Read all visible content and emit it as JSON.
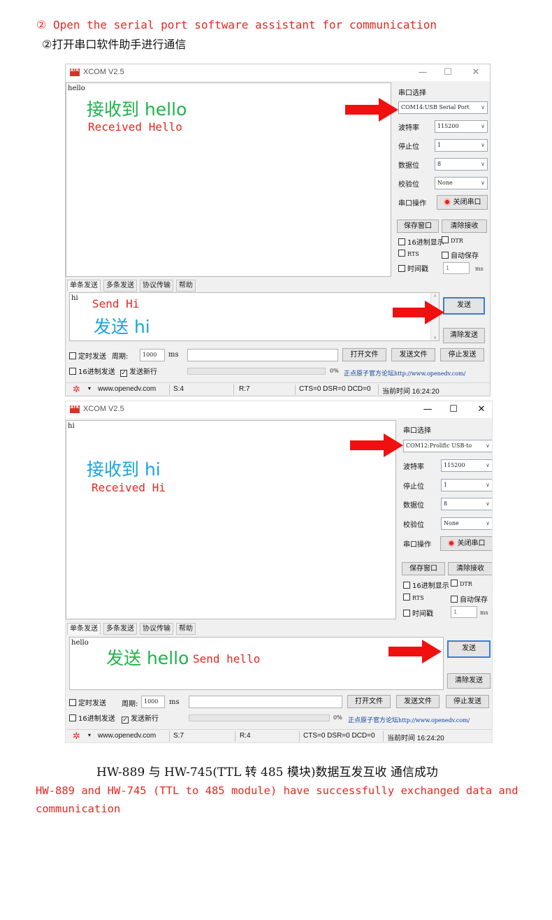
{
  "header": {
    "step_en": "② Open the serial port software assistant for communication",
    "step_cn": "②打开串口软件助手进行通信"
  },
  "windows": [
    {
      "title": "XCOM V2.5",
      "app_icon_text": "ATK",
      "window_buttons": {
        "minimize": "—",
        "maximize": "☐",
        "close": "✕"
      },
      "receive_text": "hello",
      "annotation_cn": "接收到 hello",
      "annotation_en": "Received Hello",
      "settings": {
        "port_label": "串口选择",
        "port_value": "COM14:USB Serial Port",
        "baud_label": "波特率",
        "baud_value": "115200",
        "stop_label": "停止位",
        "stop_value": "1",
        "data_label": "数据位",
        "data_value": "8",
        "parity_label": "校验位",
        "parity_value": "None",
        "op_label": "串口操作",
        "op_button": "关闭串口"
      },
      "buttons": {
        "save_window": "保存窗口",
        "clear_receive": "清除接收"
      },
      "checks": {
        "hex_display": "16进制显示",
        "dtr": "DTR",
        "rts": "RTS",
        "auto_save": "自动保存",
        "timestamp": "时间戳"
      },
      "timestamp_value": "1",
      "ms_unit": "ms",
      "tabs": [
        "单条发送",
        "多条发送",
        "协议传输",
        "帮助"
      ],
      "send_text": "hi",
      "send_annotation_en": "Send Hi",
      "send_annotation_cn": "发送 hi",
      "send_button": "发送",
      "clear_send_button": "清除发送",
      "timed_send": "定时发送",
      "period_label": "周期:",
      "period_value": "1000",
      "period_unit": "ms",
      "open_file": "打开文件",
      "send_file": "发送文件",
      "stop_send": "停止发送",
      "hex_send": "16进制发送",
      "send_newline": "发送新行",
      "progress_pct": "0%",
      "progress_fraction": 0,
      "forum_link_cn": "正点原子官方论坛",
      "forum_link_url": "http://www.openedv.com/",
      "status": {
        "site": "www.openedv.com",
        "sent": "S:4",
        "received": "R:7",
        "signals": "CTS=0 DSR=0 DCD=0",
        "time": "当前时间 16:24:20"
      }
    },
    {
      "title": "XCOM V2.5",
      "app_icon_text": "ATK",
      "window_buttons": {
        "minimize": "—",
        "maximize": "☐",
        "close": "✕"
      },
      "receive_text": "hi",
      "annotation_cn": "接收到 hi",
      "annotation_en": "Received Hi",
      "settings": {
        "port_label": "串口选择",
        "port_value": "COM12:Prolific USB-to",
        "baud_label": "波特率",
        "baud_value": "115200",
        "stop_label": "停止位",
        "stop_value": "1",
        "data_label": "数据位",
        "data_value": "8",
        "parity_label": "校验位",
        "parity_value": "None",
        "op_label": "串口操作",
        "op_button": "关闭串口"
      },
      "buttons": {
        "save_window": "保存窗口",
        "clear_receive": "清除接收"
      },
      "checks": {
        "hex_display": "16进制显示",
        "dtr": "DTR",
        "rts": "RTS",
        "auto_save": "自动保存",
        "timestamp": "时间戳"
      },
      "timestamp_value": "1",
      "ms_unit": "ms",
      "tabs": [
        "单条发送",
        "多条发送",
        "协议传输",
        "帮助"
      ],
      "send_text": "hello",
      "send_annotation_en": "Send hello",
      "send_annotation_cn": "发送 hello",
      "send_button": "发送",
      "clear_send_button": "清除发送",
      "timed_send": "定时发送",
      "period_label": "周期:",
      "period_value": "1000",
      "period_unit": "ms",
      "open_file": "打开文件",
      "send_file": "发送文件",
      "stop_send": "停止发送",
      "hex_send": "16进制发送",
      "send_newline": "发送新行",
      "progress_pct": "0%",
      "progress_fraction": 0,
      "forum_link_cn": "正点原子官方论坛",
      "forum_link_url": "http://www.openedv.com/",
      "status": {
        "site": "www.openedv.com",
        "sent": "S:7",
        "received": "R:4",
        "signals": "CTS=0 DSR=0 DCD=0",
        "time": "当前时间 16:24:20"
      }
    }
  ],
  "footer": {
    "cn": "HW-889 与 HW-745(TTL 转 485 模块)数据互发互收 通信成功",
    "en": "HW-889 and HW-745 (TTL to 485 module) have successfully exchanged data and communication"
  },
  "colors": {
    "arrow": "#f01010",
    "annotation_green": "#1fb24a",
    "annotation_blue": "#18a4dc",
    "annotation_red": "#e8261e"
  }
}
